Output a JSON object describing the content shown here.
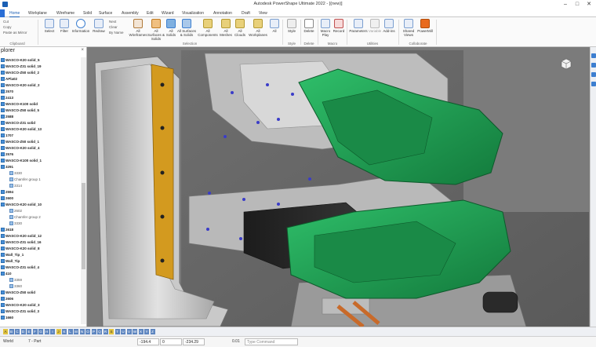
{
  "window": {
    "title": "Autodesk PowerShape Ultimate 2022 - [(new)]",
    "minimize": "–",
    "maximize": "□",
    "close": "✕"
  },
  "tabs": [
    "Home",
    "Workplane",
    "Wireframe",
    "Solid",
    "Surface",
    "Assembly",
    "Edit",
    "Wizard",
    "Visualization",
    "Annotation",
    "Draft",
    "View"
  ],
  "active_tab": "Home",
  "ribbon": {
    "clipboard_small": [
      "Cut",
      "Copy",
      "Paste as Mirror"
    ],
    "clipboard_group": "Clipboard",
    "select": "Select",
    "filter": "Filter",
    "information": "Information",
    "redraw": "Redraw",
    "next": "Next",
    "clear": "Clear",
    "by_name": "By Name",
    "all_wireframes": "All Wireframes",
    "all_surfaces_solids": "All Surfaces & Solids",
    "all_solids": "All Solids",
    "all_surfaces_solids2": "All Surfaces & Solids",
    "all_components": "All Components",
    "all_meshes": "All Meshes",
    "all_clouds": "All Clouds",
    "all_workplanes": "All Workplanes",
    "all": "All",
    "selection_group": "Selection",
    "style": "Style",
    "style_group": "Style",
    "delete": "Delete",
    "delete_group": "Delete",
    "macro_play": "Macro Play",
    "macro_record": "Record",
    "macro_group": "Macro",
    "parameters": "Parameters",
    "variable": "Variable",
    "addins": "Add-ins",
    "utilities_group": "Utilities",
    "shared_views": "Shared Views",
    "powermill": "PowerMill",
    "collaborate_group": "Collaborate"
  },
  "explorer": {
    "title": "plorer",
    "close": "×",
    "items": [
      {
        "label": "WASCO-K20 solid_5",
        "kind": "b"
      },
      {
        "label": "WASCO-Z31 solid_19",
        "kind": "b"
      },
      {
        "label": "WASCO-Z50 solid_2",
        "kind": "b"
      },
      {
        "label": "APla02",
        "kind": "b"
      },
      {
        "label": "WASCO-K20 solid_2",
        "kind": "b"
      },
      {
        "label": "2570",
        "kind": "b"
      },
      {
        "label": "2413",
        "kind": "b"
      },
      {
        "label": "WASCO-K100 solid",
        "kind": "b"
      },
      {
        "label": "WASCO-Z50 solid_5",
        "kind": "b"
      },
      {
        "label": "2588",
        "kind": "b"
      },
      {
        "label": "WASCO-Z31 solid",
        "kind": "b"
      },
      {
        "label": "WASCO-K20 solid_13",
        "kind": "b"
      },
      {
        "label": "1707",
        "kind": "b"
      },
      {
        "label": "WASCO-Z50 solid_1",
        "kind": "b"
      },
      {
        "label": "WASCO-K20 solid_4",
        "kind": "b"
      },
      {
        "label": "2576",
        "kind": "b"
      },
      {
        "label": "WASCO-K100 solid_1",
        "kind": "b"
      },
      {
        "label": "3291",
        "kind": "b"
      },
      {
        "label": "3330",
        "kind": "sub"
      },
      {
        "label": "Chamfer group 1",
        "kind": "sub"
      },
      {
        "label": "3314",
        "kind": "sub"
      },
      {
        "label": "2594",
        "kind": "b"
      },
      {
        "label": "2600",
        "kind": "b"
      },
      {
        "label": "WASCO-K20 solid_10",
        "kind": "b"
      },
      {
        "label": "2602",
        "kind": "sub"
      },
      {
        "label": "Chamfer group 2",
        "kind": "sub"
      },
      {
        "label": "3330",
        "kind": "sub"
      },
      {
        "label": "2618",
        "kind": "b"
      },
      {
        "label": "WASCO-K20 solid_12",
        "kind": "b"
      },
      {
        "label": "WASCO-Z31 solid_16",
        "kind": "b"
      },
      {
        "label": "WASCO-K20 solid_8",
        "kind": "b"
      },
      {
        "label": "Wall_Tip_1",
        "kind": "b"
      },
      {
        "label": "Wall_Tip",
        "kind": "b"
      },
      {
        "label": "WASCO-Z31 solid_4",
        "kind": "b"
      },
      {
        "label": "410",
        "kind": "b"
      },
      {
        "label": "3359",
        "kind": "sub"
      },
      {
        "label": "3360",
        "kind": "sub"
      },
      {
        "label": "WASCO-Z50 solid",
        "kind": "b"
      },
      {
        "label": "2606",
        "kind": "b"
      },
      {
        "label": "WASCO-K20 solid_3",
        "kind": "b"
      },
      {
        "label": "WASCO-Z31 solid_3",
        "kind": "b"
      },
      {
        "label": "1660",
        "kind": "b"
      }
    ]
  },
  "levels": [
    "A",
    "B",
    "C",
    "D",
    "E",
    "F",
    "G",
    "H",
    "I",
    "J",
    "K",
    "L",
    "M",
    "N",
    "O",
    "P",
    "Q",
    "R",
    "S",
    "T",
    "U",
    "V",
    "W",
    "X",
    "Y",
    "Z"
  ],
  "bottom": {
    "world": "World",
    "units": "7 - Part",
    "coord_x": "-194.4",
    "coord_y": "0",
    "coord_z": "-234.29",
    "tolerance": "0.01",
    "command_placeholder": "Type Command"
  },
  "colors": {
    "accent": "#1a5fb4",
    "green_part": "#1f9a52",
    "yellow_bar": "#d39a1f",
    "viewport_bg": "#9a9a9a"
  }
}
